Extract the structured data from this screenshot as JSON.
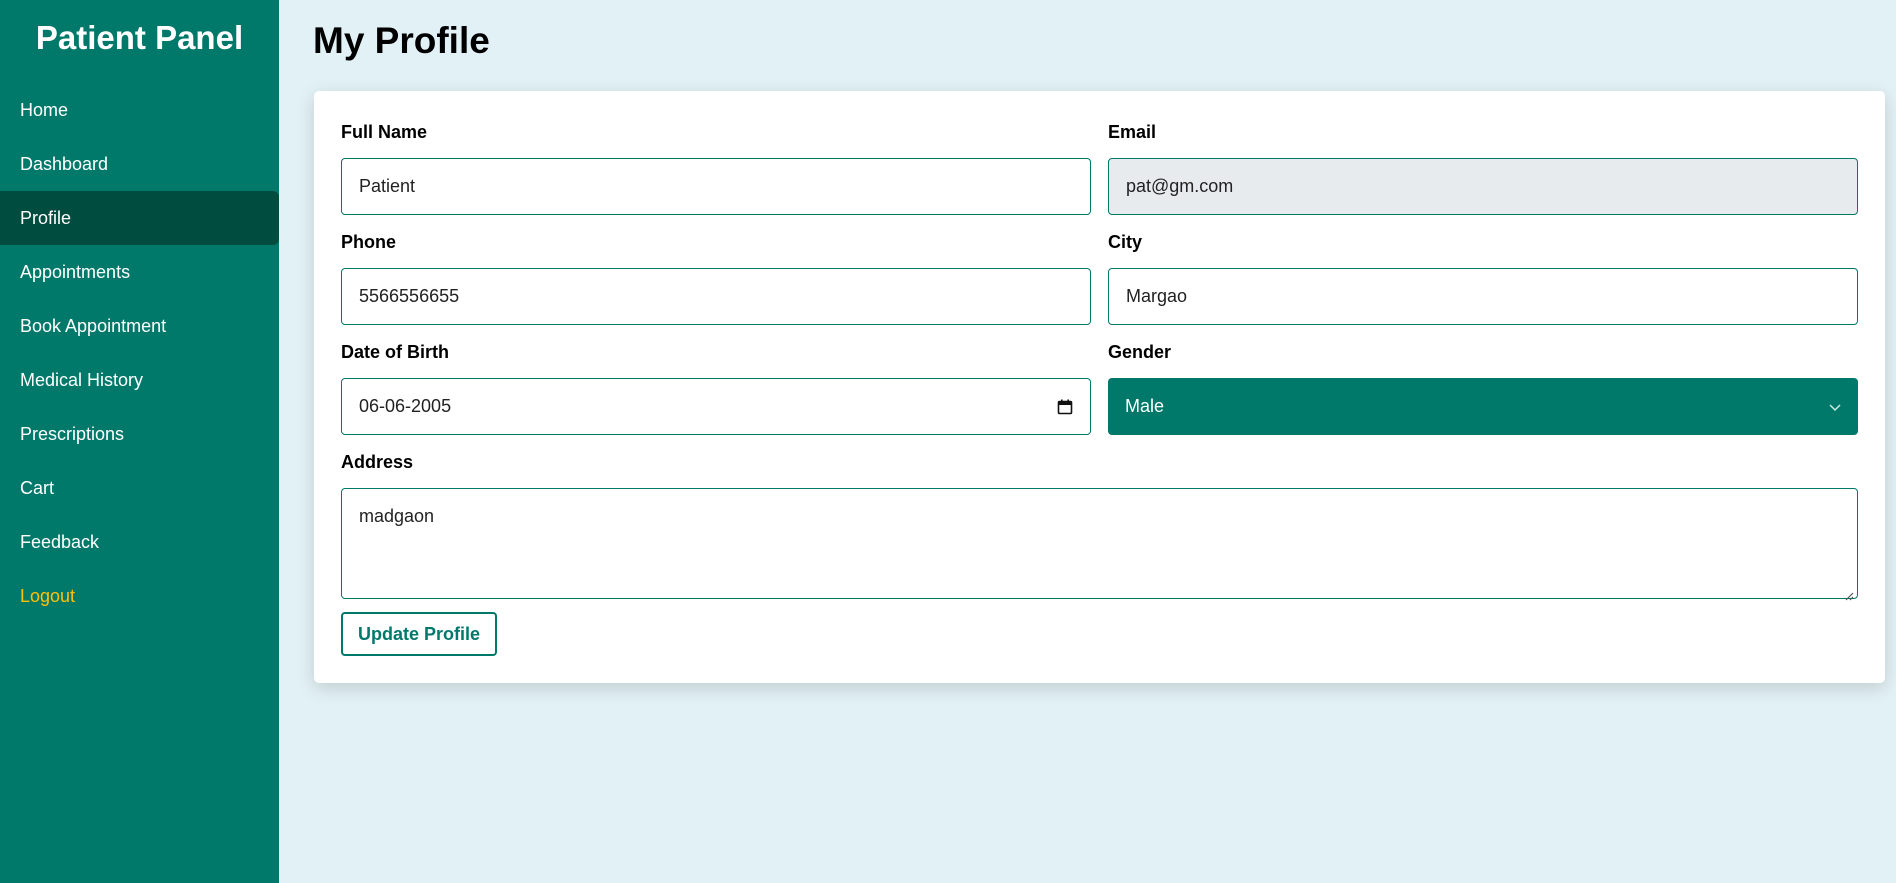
{
  "sidebar": {
    "brand": "Patient Panel",
    "items": [
      {
        "label": "Home"
      },
      {
        "label": "Dashboard"
      },
      {
        "label": "Profile"
      },
      {
        "label": "Appointments"
      },
      {
        "label": "Book Appointment"
      },
      {
        "label": "Medical History"
      },
      {
        "label": "Prescriptions"
      },
      {
        "label": "Cart"
      },
      {
        "label": "Feedback"
      },
      {
        "label": "Logout"
      }
    ],
    "active_item": "Profile"
  },
  "page": {
    "title": "My Profile"
  },
  "form": {
    "full_name": {
      "label": "Full Name",
      "value": "Patient"
    },
    "email": {
      "label": "Email",
      "value": "pat@gm.com"
    },
    "phone": {
      "label": "Phone",
      "value": "5566556655"
    },
    "city": {
      "label": "City",
      "value": "Margao"
    },
    "dob": {
      "label": "Date of Birth",
      "value": "06-06-2005"
    },
    "gender": {
      "label": "Gender",
      "value": "Male"
    },
    "address": {
      "label": "Address",
      "value": "madgaon"
    },
    "submit_label": "Update Profile"
  },
  "colors": {
    "primary": "#00796b",
    "active": "#004d40",
    "logout": "#ffc107",
    "background": "#e2f1f5"
  },
  "icons": {
    "date_picker": "calendar-icon",
    "dropdown": "chevron-down-icon"
  }
}
